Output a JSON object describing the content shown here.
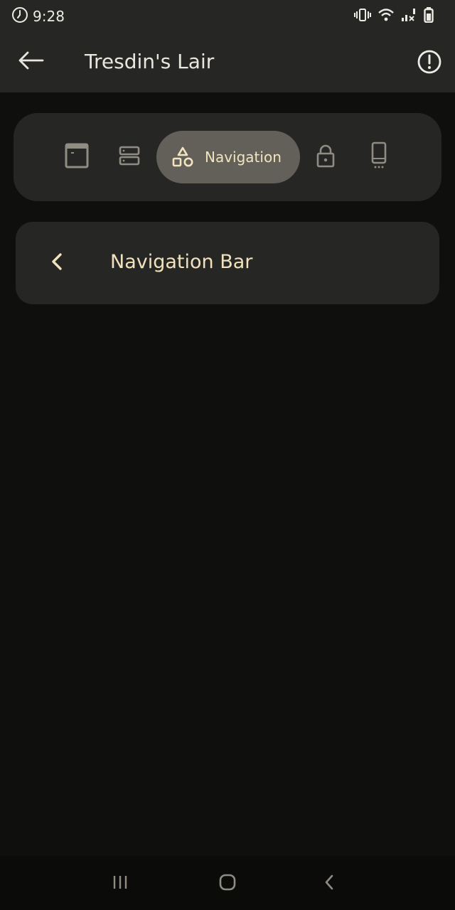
{
  "status_bar": {
    "time": "9:28",
    "icons": [
      "alarm-icon",
      "vibrate-icon",
      "wifi-icon",
      "signal-icon",
      "battery-icon"
    ]
  },
  "app_bar": {
    "title": "Tresdin's Lair",
    "back_icon": "arrow-left-icon",
    "info_icon": "info-circle-icon"
  },
  "tabs": {
    "items": [
      {
        "icon": "window-icon",
        "label": ""
      },
      {
        "icon": "server-icon",
        "label": ""
      },
      {
        "icon": "shapes-icon",
        "label": "Navigation",
        "active": true
      },
      {
        "icon": "lock-icon",
        "label": ""
      },
      {
        "icon": "phone-icon",
        "label": ""
      }
    ],
    "active_label": "Navigation"
  },
  "navigation_item": {
    "label": "Navigation Bar",
    "icon": "chevron-left-icon"
  },
  "system_nav": {
    "icons": [
      "recent-apps-icon",
      "home-icon",
      "system-back-icon"
    ]
  },
  "colors": {
    "background": "#0f0f0d",
    "surface": "#262624",
    "active_pill": "#626058",
    "accent": "#f1e2bd",
    "inactive_icon": "#8f8c84"
  }
}
